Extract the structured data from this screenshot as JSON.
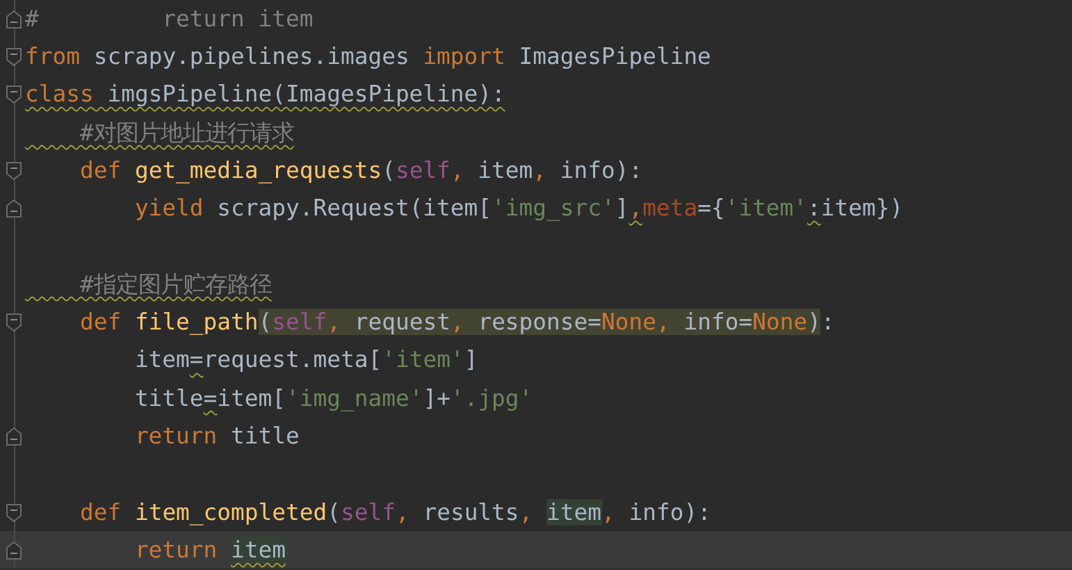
{
  "editor": {
    "lines": [
      {
        "kind": "fold_end",
        "current": false,
        "tokens": [
          {
            "t": "#         return item",
            "kind": "comment"
          }
        ]
      },
      {
        "kind": "fold_start",
        "current": false,
        "tokens": [
          {
            "t": "from",
            "kind": "keyword"
          },
          {
            "t": " scrapy.pipelines.images ",
            "kind": "plain"
          },
          {
            "t": "import",
            "kind": "keyword"
          },
          {
            "t": " ImagesPipeline",
            "kind": "plain"
          }
        ]
      },
      {
        "kind": "fold_start",
        "current": false,
        "tokens": [
          {
            "t": "class",
            "kind": "keyword",
            "warn": true
          },
          {
            "t": " imgsPipeline(ImagesPipeline):",
            "kind": "plain",
            "warn": true
          }
        ]
      },
      {
        "kind": "plain",
        "current": false,
        "tokens": [
          {
            "t": "    #对图片地址进行请求",
            "kind": "comment",
            "warn": true
          }
        ]
      },
      {
        "kind": "fold_start",
        "current": false,
        "tokens": [
          {
            "t": "    def ",
            "kind": "keyword"
          },
          {
            "t": "get_media_requests",
            "kind": "function"
          },
          {
            "t": "(",
            "kind": "plain"
          },
          {
            "t": "self",
            "kind": "self"
          },
          {
            "t": ",",
            "kind": "keyword"
          },
          {
            "t": " item",
            "kind": "plain"
          },
          {
            "t": ",",
            "kind": "keyword"
          },
          {
            "t": " info):",
            "kind": "plain"
          }
        ]
      },
      {
        "kind": "fold_end",
        "current": false,
        "tokens": [
          {
            "t": "        yield",
            "kind": "keyword"
          },
          {
            "t": " scrapy.Request(item[",
            "kind": "plain"
          },
          {
            "t": "'img_src'",
            "kind": "string"
          },
          {
            "t": "]",
            "kind": "plain"
          },
          {
            "t": ",",
            "kind": "keyword",
            "warn": true
          },
          {
            "t": "meta",
            "kind": "param"
          },
          {
            "t": "={",
            "kind": "plain"
          },
          {
            "t": "'item'",
            "kind": "string"
          },
          {
            "t": ":",
            "kind": "plain",
            "warn": true
          },
          {
            "t": "item})",
            "kind": "plain"
          }
        ]
      },
      {
        "kind": "plain",
        "current": false
      },
      {
        "kind": "plain",
        "current": false,
        "tokens": [
          {
            "t": "    #指定图片贮存路径",
            "kind": "comment",
            "warn": true
          }
        ]
      },
      {
        "kind": "fold_start",
        "current": false,
        "tokens": [
          {
            "t": "    def ",
            "kind": "keyword"
          },
          {
            "t": "file_path",
            "kind": "function"
          },
          {
            "t": "(",
            "kind": "plain",
            "brace_match": true
          },
          {
            "t": "self",
            "kind": "self",
            "brace_match": true
          },
          {
            "t": ",",
            "kind": "keyword",
            "brace_match": true
          },
          {
            "t": " request",
            "kind": "plain",
            "brace_match": true
          },
          {
            "t": ",",
            "kind": "keyword",
            "brace_match": true
          },
          {
            "t": " response=",
            "kind": "plain",
            "brace_match": true
          },
          {
            "t": "None",
            "kind": "keyword",
            "brace_match": true
          },
          {
            "t": ",",
            "kind": "keyword",
            "brace_match": true
          },
          {
            "t": " info=",
            "kind": "plain",
            "brace_match": true
          },
          {
            "t": "None",
            "kind": "keyword",
            "brace_match": true
          },
          {
            "t": ")",
            "kind": "plain",
            "brace_match": true
          },
          {
            "t": ":",
            "kind": "plain"
          }
        ]
      },
      {
        "kind": "plain",
        "current": false,
        "tokens": [
          {
            "t": "        item",
            "kind": "plain"
          },
          {
            "t": "=",
            "kind": "plain",
            "warn": true
          },
          {
            "t": "request.meta[",
            "kind": "plain"
          },
          {
            "t": "'item'",
            "kind": "string"
          },
          {
            "t": "]",
            "kind": "plain"
          }
        ]
      },
      {
        "kind": "plain",
        "current": false,
        "tokens": [
          {
            "t": "        title",
            "kind": "plain"
          },
          {
            "t": "=",
            "kind": "plain",
            "warn": true
          },
          {
            "t": "item[",
            "kind": "plain"
          },
          {
            "t": "'img_name'",
            "kind": "string"
          },
          {
            "t": "]+",
            "kind": "plain"
          },
          {
            "t": "'.jpg'",
            "kind": "string"
          }
        ]
      },
      {
        "kind": "fold_end",
        "current": false,
        "tokens": [
          {
            "t": "        return",
            "kind": "keyword"
          },
          {
            "t": " title",
            "kind": "plain"
          }
        ]
      },
      {
        "kind": "plain",
        "current": false
      },
      {
        "kind": "fold_start",
        "current": false,
        "tokens": [
          {
            "t": "    def ",
            "kind": "keyword"
          },
          {
            "t": "item_completed",
            "kind": "function"
          },
          {
            "t": "(",
            "kind": "plain"
          },
          {
            "t": "self",
            "kind": "self"
          },
          {
            "t": ",",
            "kind": "keyword"
          },
          {
            "t": " results",
            "kind": "plain"
          },
          {
            "t": ", ",
            "kind": "keyword"
          },
          {
            "t": "item",
            "kind": "plain",
            "usage": true
          },
          {
            "t": ",",
            "kind": "keyword"
          },
          {
            "t": " info):",
            "kind": "plain"
          }
        ]
      },
      {
        "kind": "fold_end",
        "current": true,
        "tokens": [
          {
            "t": "        return ",
            "kind": "keyword"
          },
          {
            "t": "item",
            "kind": "plain",
            "usage": true,
            "warn": true
          }
        ]
      }
    ]
  }
}
